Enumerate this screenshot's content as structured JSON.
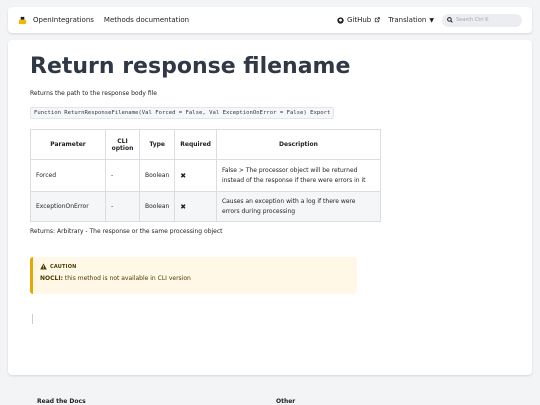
{
  "navbar": {
    "brand": "OpenIntegrations",
    "links": [
      "Methods documentation"
    ],
    "github": "GitHub",
    "translation": "Translation",
    "search_placeholder": "Search Ctrl K"
  },
  "page": {
    "title": "Return response filename",
    "description": "Returns the path to the response body file",
    "signature": "Function ReturnResponseFilename(Val Forced = False, Val ExceptionOnError = False) Export"
  },
  "table": {
    "headers": [
      "Parameter",
      "CLI option",
      "Type",
      "Required",
      "Description"
    ],
    "rows": [
      [
        "Forced",
        "-",
        "Boolean",
        "✖",
        "False > The processor object will be returned instead of the response if there were errors in it"
      ],
      [
        "ExceptionOnError",
        "-",
        "Boolean",
        "✖",
        "Causes an exception with a log if there were errors during processing"
      ]
    ]
  },
  "returns": "Returns: Arbitrary - The response or the same processing object",
  "caution": {
    "label": "CAUTION",
    "strong": "NOCLI:",
    "text": " this method is not available in CLI version"
  },
  "footer": {
    "left": "Read the Docs",
    "right": "Other"
  },
  "colors": {
    "caution_border": "#e6a700",
    "caution_bg": "#fff8e6"
  }
}
